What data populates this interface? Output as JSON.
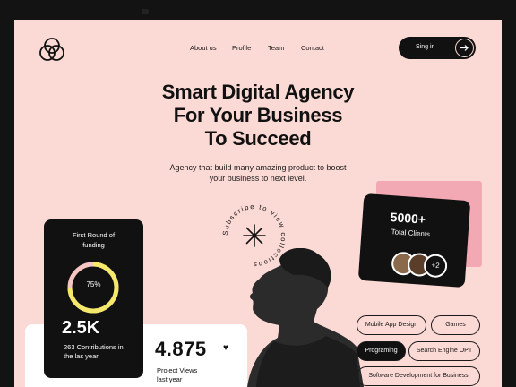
{
  "nav": {
    "items": [
      "About us",
      "Profile",
      "Team",
      "Contact"
    ],
    "signin_label": "Sing in"
  },
  "hero": {
    "lines": [
      "Smart Digital Agency",
      "For Your Business",
      "To Succeed"
    ],
    "subtitle_lines": [
      "Agency that build many amazing product to boost",
      "your business to next level."
    ],
    "badge_text": "Subscribe to view collections"
  },
  "funding_card": {
    "title_lines": [
      "First Round of",
      "funding"
    ],
    "progress_percent": 75,
    "progress_label": "75%",
    "stat_value": "2.5K",
    "stat_lines": [
      "263 Contributions in",
      "the las year"
    ]
  },
  "views": {
    "value": "4.875",
    "label_lines": [
      "Project Views",
      "last year"
    ]
  },
  "clients_card": {
    "value": "5000+",
    "label": "Total Clients",
    "more_label": "+2"
  },
  "tags": [
    "Mobile App Design",
    "Games",
    "Programing",
    "Search Engine OPT",
    "Software Development for Business"
  ],
  "colors": {
    "page_background": "#fbd9d4",
    "dark": "#111111",
    "accent_pink": "#f3a9b3",
    "progress_yellow": "#f5e86a"
  }
}
